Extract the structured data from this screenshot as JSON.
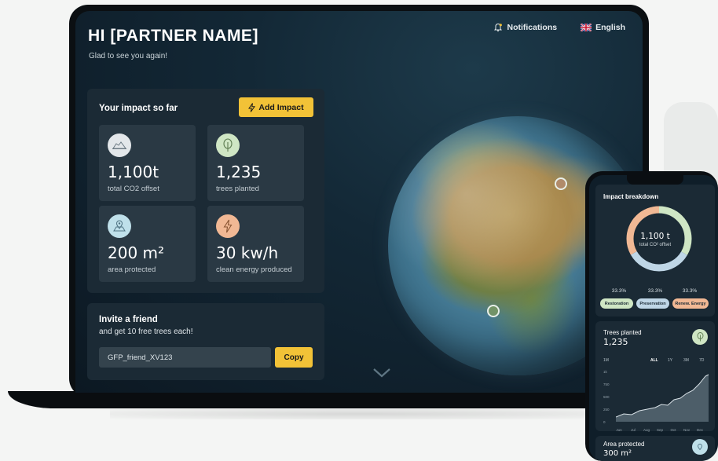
{
  "greeting": {
    "title": "HI [PARTNER NAME]",
    "subtitle": "Glad to see you again!"
  },
  "topnav": {
    "notifications": "Notifications",
    "language": "English",
    "notifications_icon": "bell-icon",
    "language_icon": "uk-flag-icon"
  },
  "impact": {
    "title": "Your impact so far",
    "add_button": "Add Impact",
    "add_button_icon": "lightning-icon",
    "stats": [
      {
        "value": "1,100t",
        "label": "total CO2 offset",
        "icon": "cloud-icon",
        "icon_color": "#e3e7ea"
      },
      {
        "value": "1,235",
        "label": "trees planted",
        "icon": "tree-icon",
        "icon_color": "#cfe6c4"
      },
      {
        "value": "200 m²",
        "label": "area protected",
        "icon": "map-pin-icon",
        "icon_color": "#bfe0ea"
      },
      {
        "value": "30 kw/h",
        "label": "clean energy produced",
        "icon": "lightning-icon",
        "icon_color": "#f1b894"
      }
    ]
  },
  "invite": {
    "title": "Invite a friend",
    "subtitle": "and get 10 free trees each!",
    "code": "GFP_friend_XV123",
    "copy_button": "Copy"
  },
  "phone": {
    "breakdown": {
      "title": "Impact breakdown",
      "center_value": "1,100 t",
      "center_label": "total CO² offset",
      "segments": [
        {
          "label": "Restoration",
          "percent": "33.3%",
          "color": "#cfe6c4"
        },
        {
          "label": "Preservation",
          "percent": "33.3%",
          "color": "#bfd6e6"
        },
        {
          "label": "Renew. Energy",
          "percent": "33.3%",
          "color": "#f1b894"
        }
      ]
    },
    "trees": {
      "title": "Trees planted",
      "value": "1,235",
      "ranges": [
        "1M",
        "ALL",
        "1Y",
        "3M",
        "7D"
      ],
      "active_range": "ALL",
      "y_ticks": [
        "1k",
        "750",
        "500",
        "250",
        "0"
      ],
      "x_ticks": [
        "Jun",
        "Jul",
        "Aug",
        "Sep",
        "Oct",
        "Nov",
        "Dec"
      ]
    },
    "area": {
      "title": "Area protected",
      "value": "300 m²"
    }
  },
  "colors": {
    "accent": "#f2c237",
    "panel": "#1b2a35",
    "card": "#2a3944",
    "screen": "#132836"
  }
}
